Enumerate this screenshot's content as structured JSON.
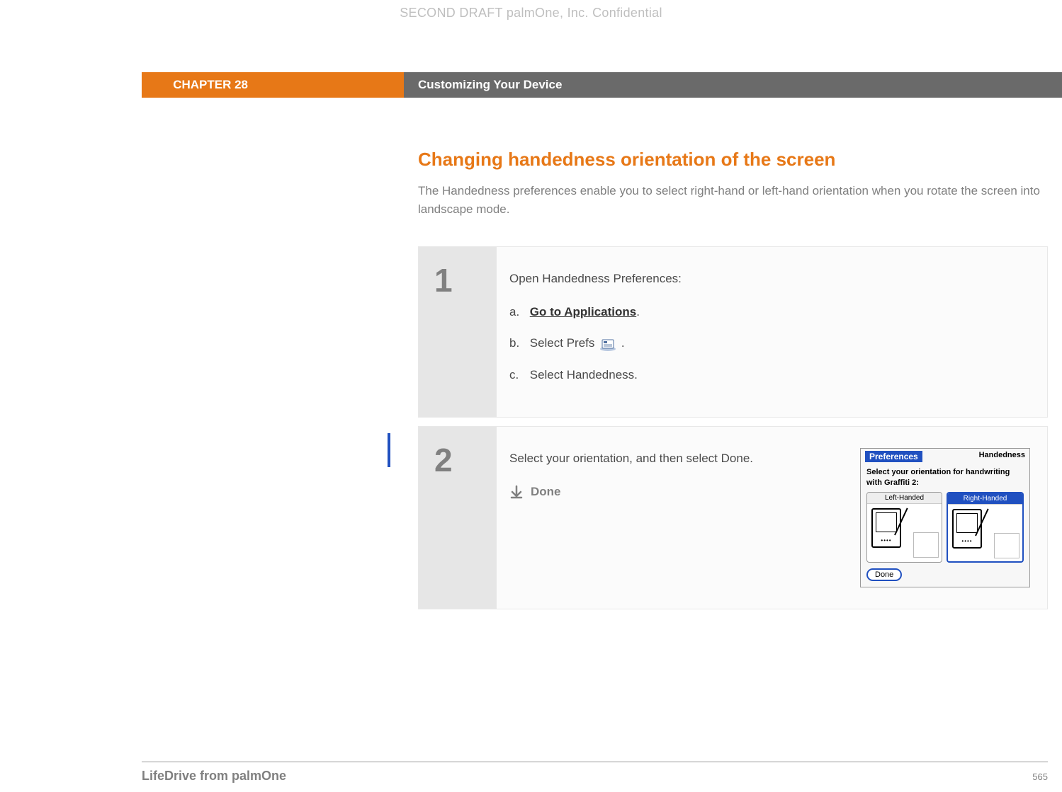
{
  "watermark": "SECOND DRAFT palmOne, Inc.  Confidential",
  "chapter": {
    "label": "CHAPTER 28",
    "title": "Customizing Your Device"
  },
  "section": {
    "title": "Changing handedness orientation of the screen",
    "intro": "The Handedness preferences enable you to select right-hand or left-hand orientation when you rotate the screen into landscape mode."
  },
  "steps": [
    {
      "number": "1",
      "lead": "Open Handedness Preferences:",
      "sub": [
        {
          "letter": "a.",
          "before": "",
          "link": "Go to Applications",
          "after": "."
        },
        {
          "letter": "b.",
          "before": "Select Prefs ",
          "icon": true,
          "after": " ."
        },
        {
          "letter": "c.",
          "before": "Select Handedness.",
          "after": ""
        }
      ]
    },
    {
      "number": "2",
      "text": "Select your orientation, and then select Done.",
      "done_label": "Done",
      "screenshot": {
        "header_left": "Preferences",
        "header_right": "Handedness",
        "instruction": "Select your orientation for handwriting with Graffiti 2:",
        "options": [
          "Left-Handed",
          "Right-Handed"
        ],
        "selected": 1,
        "done_button": "Done"
      }
    }
  ],
  "footer": {
    "left": "LifeDrive from palmOne",
    "page": "565"
  }
}
